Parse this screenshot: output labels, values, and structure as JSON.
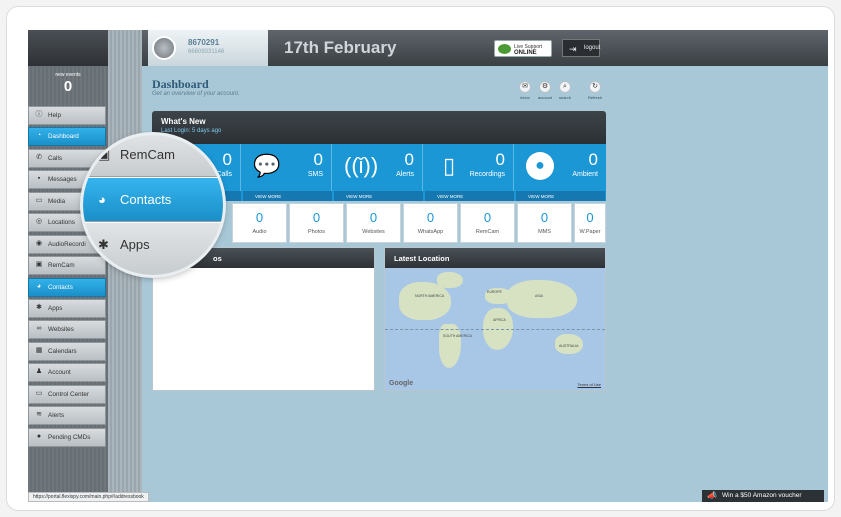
{
  "header": {
    "username": "8670291",
    "user_number": "66809331146",
    "date": "17th February",
    "support": {
      "label": "Live Support",
      "status": "ONLINE"
    },
    "logout_label": "logout"
  },
  "events": {
    "label": "new events",
    "count": "0"
  },
  "sidebar": {
    "items": [
      {
        "label": "Help",
        "icon": "info-icon"
      },
      {
        "label": "Dashboard",
        "icon": "dashboard-icon"
      },
      {
        "label": "Calls",
        "icon": "phone-icon"
      },
      {
        "label": "Messages",
        "icon": "message-icon"
      },
      {
        "label": "Media",
        "icon": "media-icon"
      },
      {
        "label": "Locations",
        "icon": "location-icon"
      },
      {
        "label": "AudioRecordi",
        "icon": "microphone-icon"
      },
      {
        "label": "RemCam",
        "icon": "camera-icon"
      },
      {
        "label": "Contacts",
        "icon": "contacts-icon"
      },
      {
        "label": "Apps",
        "icon": "apps-icon"
      },
      {
        "label": "Websites",
        "icon": "link-icon"
      },
      {
        "label": "Calendars",
        "icon": "calendar-icon"
      },
      {
        "label": "Account",
        "icon": "user-icon"
      },
      {
        "label": "Control Center",
        "icon": "monitor-icon"
      },
      {
        "label": "Alerts",
        "icon": "alert-icon"
      },
      {
        "label": "Pending CMDs",
        "icon": "pending-icon"
      }
    ]
  },
  "dashboard": {
    "title": "Dashboard",
    "subtitle": "Get an overview of your account.",
    "tools": [
      {
        "label": "inbox"
      },
      {
        "label": "account"
      },
      {
        "label": "search"
      },
      {
        "label": "Refresh"
      }
    ]
  },
  "whats_new": {
    "title": "What's New",
    "subtitle": "Last Login: 5 days ago"
  },
  "tiles": [
    {
      "count": "0",
      "label": "Calls",
      "view_more": "",
      "icon": "phone-icon"
    },
    {
      "count": "0",
      "label": "SMS",
      "view_more": "VIEW MORE",
      "icon": "speech-bubble-icon"
    },
    {
      "count": "0",
      "label": "Alerts",
      "view_more": "VIEW MORE",
      "icon": "antenna-icon"
    },
    {
      "count": "0",
      "label": "Recordings",
      "view_more": "VIEW MORE",
      "icon": "smartphone-icon"
    },
    {
      "count": "0",
      "label": "Ambient",
      "view_more": "VIEW MORE",
      "icon": "microphone-icon"
    }
  ],
  "counters": [
    {
      "count": "0",
      "label": "Audio"
    },
    {
      "count": "0",
      "label": "Photos"
    },
    {
      "count": "0",
      "label": "Websites"
    },
    {
      "count": "0",
      "label": "WhatsApp"
    },
    {
      "count": "0",
      "label": "RemCam"
    },
    {
      "count": "0",
      "label": "MMS"
    },
    {
      "count": "0",
      "label": "W.Paper"
    }
  ],
  "panels": {
    "left_title": "os",
    "location_title": "Latest Location",
    "map": {
      "labels": [
        "NORTH AMERICA",
        "EUROPE",
        "ASIA",
        "AFRICA",
        "SOUTH AMERICA",
        "AUSTRALIA"
      ],
      "google": "Google",
      "terms": "Terms of Use"
    }
  },
  "magnifier": {
    "items": [
      {
        "label": "RemCam",
        "icon": "camera-icon"
      },
      {
        "label": "Contacts",
        "icon": "contacts-icon"
      },
      {
        "label": "Apps",
        "icon": "apps-icon"
      }
    ]
  },
  "status_url": "https://portal.flexispy.com/main.php#/addressbook",
  "voucher": "Win a $50 Amazon voucher",
  "colors": {
    "accent": "#1c97d6",
    "background": "#a9c8d7",
    "header": "#3a3f44"
  }
}
